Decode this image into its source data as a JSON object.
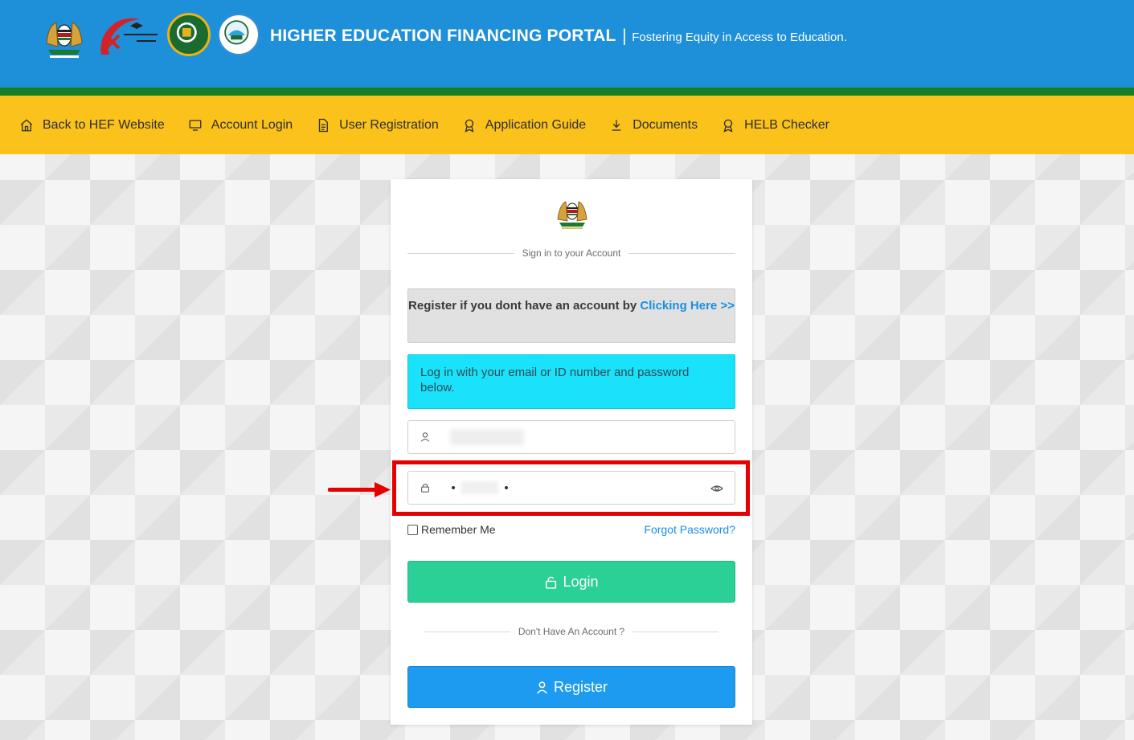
{
  "header": {
    "title": "HIGHER EDUCATION FINANCING PORTAL",
    "separator": "|",
    "subtitle": "Fostering Equity in Access to Education.",
    "colors": {
      "topbar": "#1e8fd9",
      "stripe": "#148024",
      "navbar": "#fbc21b"
    },
    "logos": [
      "kenya-coat-of-arms-logo",
      "red-swoosh-logo",
      "helb-logo",
      "university-fund-logo"
    ]
  },
  "nav": {
    "items": [
      {
        "label": "Back to HEF Website",
        "icon": "home-icon"
      },
      {
        "label": "Account Login",
        "icon": "monitor-icon"
      },
      {
        "label": "User Registration",
        "icon": "document-icon"
      },
      {
        "label": "Application Guide",
        "icon": "award-icon"
      },
      {
        "label": "Documents",
        "icon": "download-icon"
      },
      {
        "label": "HELB Checker",
        "icon": "award-icon"
      }
    ]
  },
  "card": {
    "emblem": "kenya-coat-of-arms-icon",
    "signin_divider": "Sign in to your Account",
    "register_alert": {
      "text": "Register if you dont have an account by ",
      "link": "Clicking Here >>"
    },
    "info_alert": "Log in with your email or ID number and password below.",
    "username": {
      "icon": "user-icon",
      "value": ""
    },
    "password": {
      "icon": "lock-icon",
      "toggle_icon": "eye-icon"
    },
    "remember_label": "Remember Me",
    "forgot_label": "Forgot Password?",
    "login_label": "Login",
    "no_account_divider": "Don't Have An Account ?",
    "register_label": "Register",
    "colors": {
      "login": "#2bd097",
      "register": "#1d9bf0",
      "info": "#1be2fb",
      "link": "#1a8fe0"
    }
  },
  "annotation": {
    "highlight_color": "#e60000"
  }
}
